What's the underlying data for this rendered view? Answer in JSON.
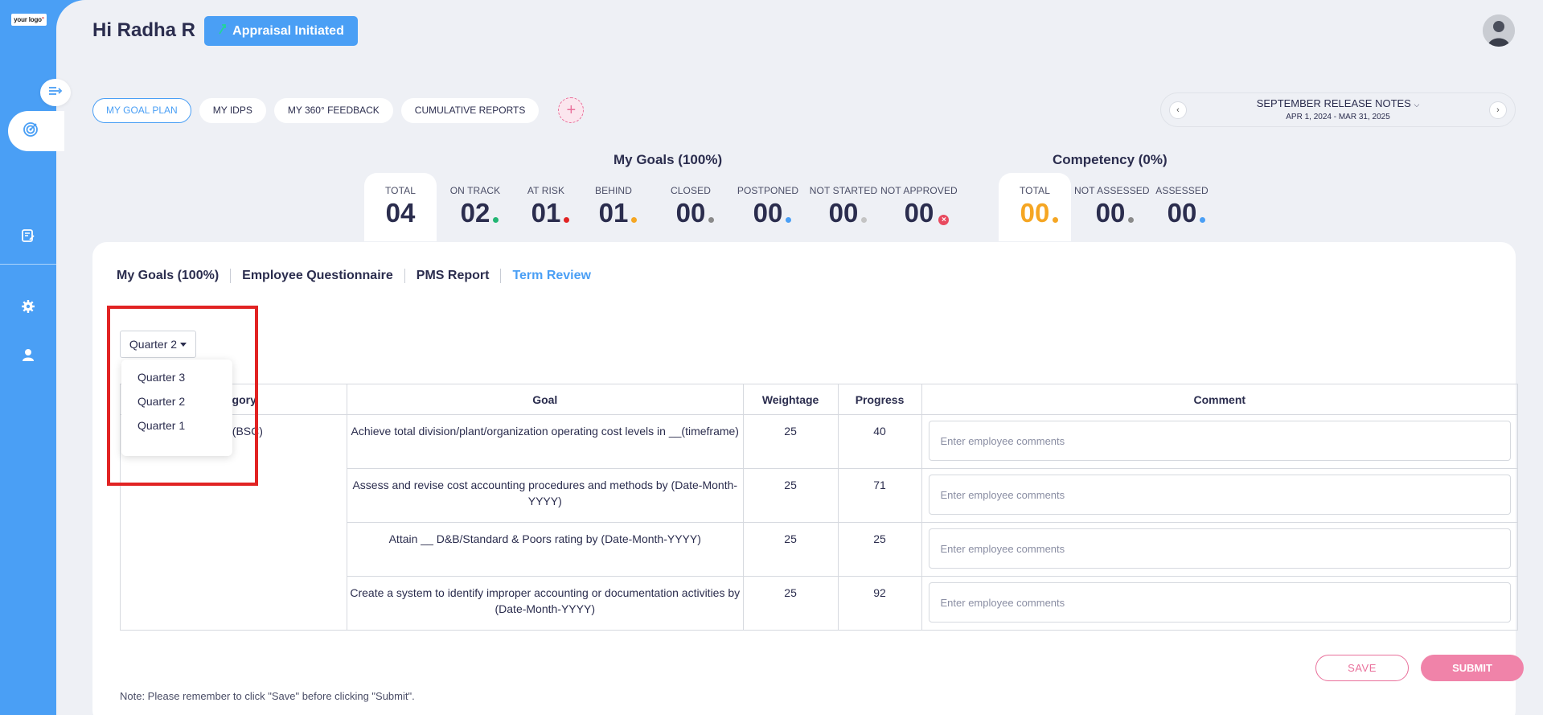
{
  "sidebar": {
    "logo": "your logo",
    "icons": [
      "collapse-icon",
      "target-icon",
      "document-edit-icon",
      "gear-icon",
      "user-icon"
    ]
  },
  "header": {
    "greeting": "Hi Radha R",
    "appraisal_status": "Appraisal Initiated"
  },
  "top_tabs": [
    {
      "label": "MY GOAL PLAN",
      "active": true
    },
    {
      "label": "MY IDPS",
      "active": false
    },
    {
      "label": "MY 360° FEEDBACK",
      "active": false
    },
    {
      "label": "CUMULATIVE REPORTS",
      "active": false
    }
  ],
  "release_notes": {
    "title": "SEPTEMBER RELEASE NOTES",
    "date_range": "APR 1, 2024 - MAR 31, 2025"
  },
  "my_goals": {
    "title": "My Goals (100%)",
    "stats": [
      {
        "label": "TOTAL",
        "value": "04",
        "dot": null
      },
      {
        "label": "ON TRACK",
        "value": "02",
        "dot": "#22b573"
      },
      {
        "label": "AT RISK",
        "value": "01",
        "dot": "#e12323"
      },
      {
        "label": "BEHIND",
        "value": "01",
        "dot": "#f5a623"
      },
      {
        "label": "CLOSED",
        "value": "00",
        "dot": "#8a8a8a"
      },
      {
        "label": "POSTPONED",
        "value": "00",
        "dot": "#4a9ff5"
      },
      {
        "label": "NOT STARTED",
        "value": "00",
        "dot": "#c4c4c4"
      },
      {
        "label": "NOT APPROVED",
        "value": "00",
        "dot": "#e84a5f"
      }
    ]
  },
  "competency": {
    "title": "Competency (0%)",
    "stats": [
      {
        "label": "TOTAL",
        "value": "00",
        "dot": "#f5a623",
        "value_color": "#f5a623"
      },
      {
        "label": "NOT ASSESSED",
        "value": "00",
        "dot": "#8a8a8a"
      },
      {
        "label": "ASSESSED",
        "value": "00",
        "dot": "#4a9ff5"
      }
    ]
  },
  "sub_tabs": [
    "My Goals (100%)",
    "Employee Questionnaire",
    "PMS Report",
    "Term Review"
  ],
  "quarter_select": {
    "selected": "Quarter 2",
    "options": [
      "Quarter 3",
      "Quarter 2",
      "Quarter 1"
    ]
  },
  "table": {
    "headers": [
      "Category",
      "Goal",
      "Weightage",
      "Progress",
      "Comment"
    ],
    "category_visible": "egory",
    "category_value_visible": "al (BSC)",
    "rows": [
      {
        "goal": "Achieve total division/plant/organization operating cost levels in __(timeframe)",
        "weightage": "25",
        "progress": "40"
      },
      {
        "goal": "Assess and revise cost accounting procedures and methods by (Date-Month-YYYY)",
        "weightage": "25",
        "progress": "71"
      },
      {
        "goal": "Attain __ D&B/Standard & Poors rating by (Date-Month-YYYY)",
        "weightage": "25",
        "progress": "25"
      },
      {
        "goal": "Create a system to identify improper accounting or documentation activities by (Date-Month-YYYY)",
        "weightage": "25",
        "progress": "92"
      }
    ],
    "comment_placeholder": "Enter employee comments"
  },
  "actions": {
    "save": "SAVE",
    "submit": "SUBMIT"
  },
  "note": "Note: Please remember to click \"Save\" before clicking \"Submit\".",
  "colors": {
    "primary": "#4a9ff5",
    "pink": "#f083a9",
    "highlight": "#e12323"
  }
}
